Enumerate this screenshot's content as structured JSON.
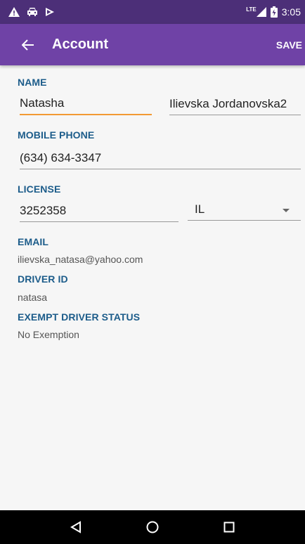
{
  "statusbar": {
    "left_icons": [
      "warning-icon",
      "car-icon",
      "play-icon"
    ],
    "network_label": "LTE",
    "time": "3:05"
  },
  "appbar": {
    "title": "Account",
    "save_label": "SAVE"
  },
  "name": {
    "label": "NAME",
    "first": "Natasha",
    "last": "Ilievska Jordanovska2"
  },
  "phone": {
    "label": "MOBILE PHONE",
    "value": "(634) 634-3347"
  },
  "license": {
    "label": "LICENSE",
    "number": "3252358",
    "state": "IL"
  },
  "email": {
    "label": "EMAIL",
    "value": "ilievska_natasa@yahoo.com"
  },
  "driver_id": {
    "label": "DRIVER ID",
    "value": "natasa"
  },
  "exempt": {
    "label": "EXEMPT DRIVER STATUS",
    "value": "No Exemption"
  },
  "colors": {
    "statusbar": "#4c2f78",
    "appbar": "#6f42a6",
    "label": "#1c5c8a",
    "focus_underline": "#f29a34"
  }
}
